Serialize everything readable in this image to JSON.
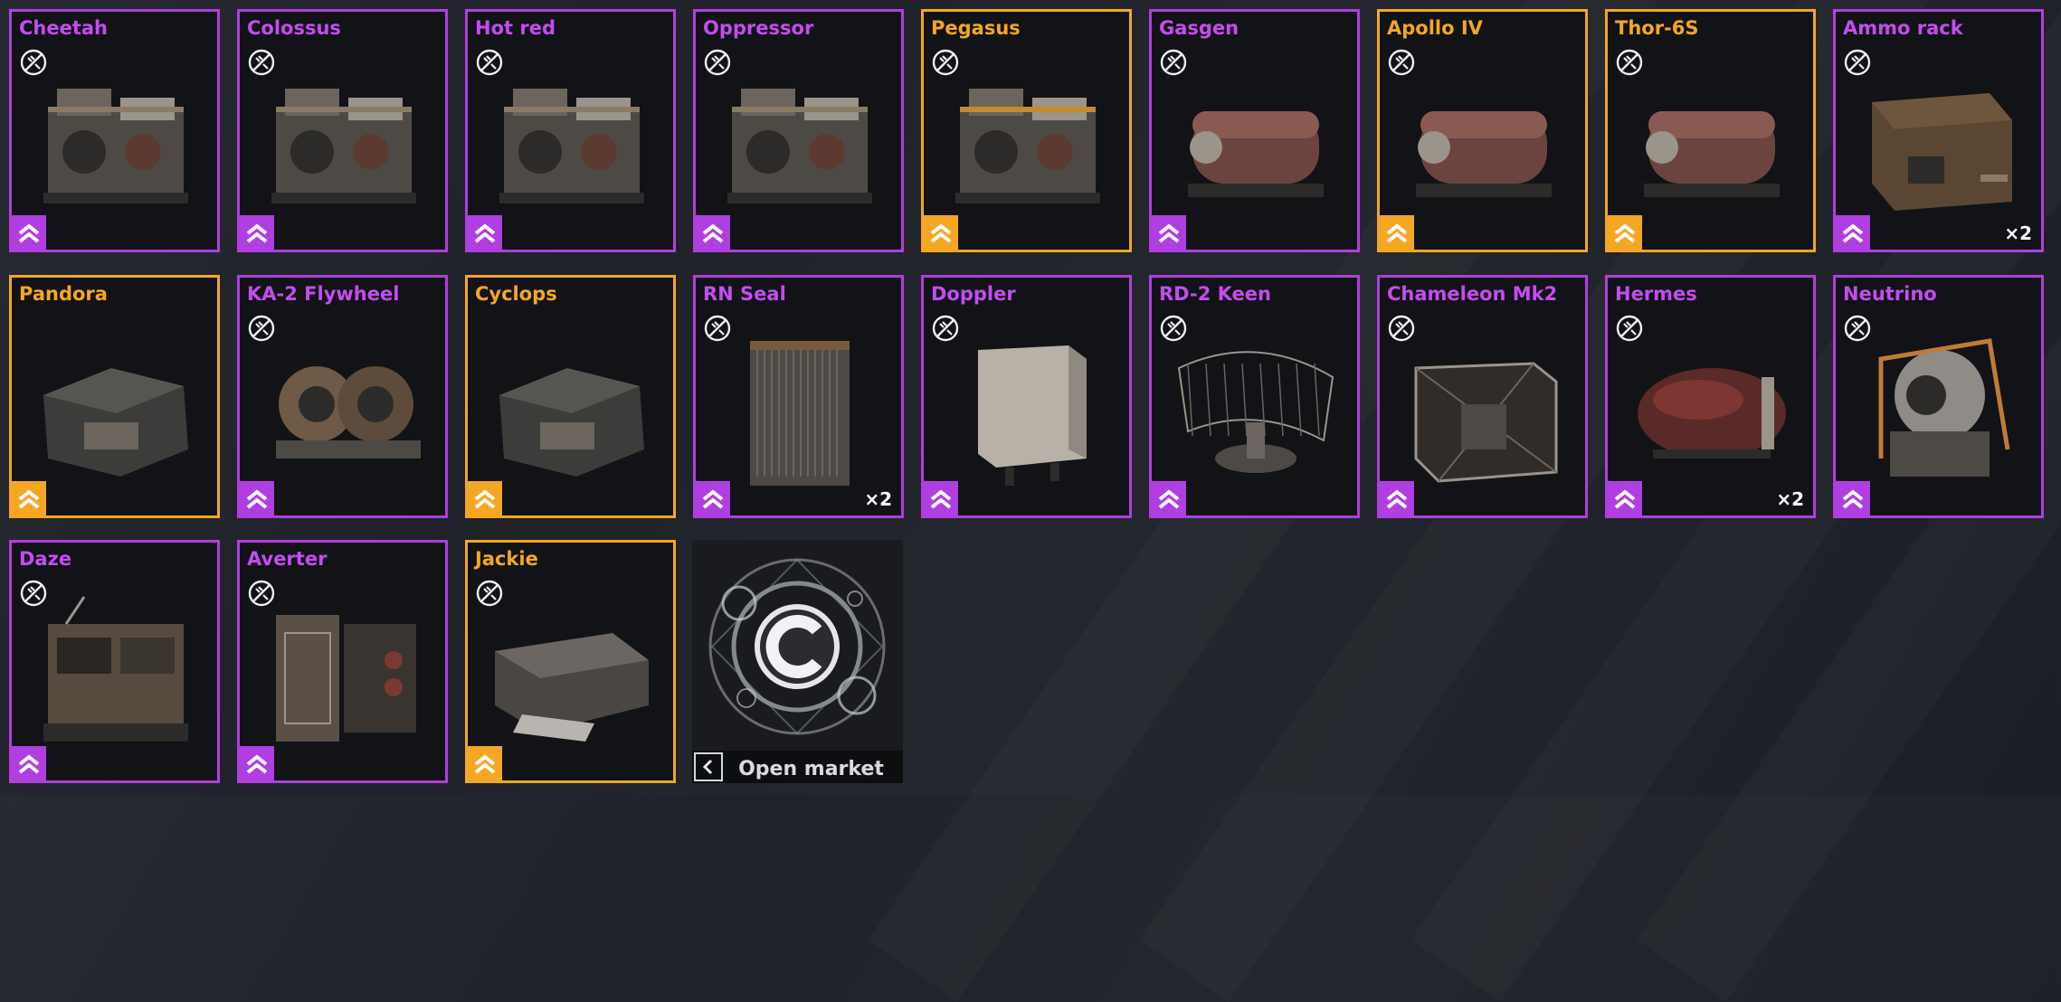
{
  "colors": {
    "epic": "#b03ee0",
    "legendary": "#f5a623",
    "card_bg": "#111316",
    "page_bg": "#22252b"
  },
  "cards": [
    {
      "name": "Cheetah",
      "rarity": "epic",
      "crafting_disabled": true,
      "quantity": null,
      "icon": "engine-icon"
    },
    {
      "name": "Colossus",
      "rarity": "epic",
      "crafting_disabled": true,
      "quantity": null,
      "icon": "engine-icon"
    },
    {
      "name": "Hot red",
      "rarity": "epic",
      "crafting_disabled": true,
      "quantity": null,
      "icon": "engine-icon"
    },
    {
      "name": "Oppressor",
      "rarity": "epic",
      "crafting_disabled": true,
      "quantity": null,
      "icon": "engine-icon"
    },
    {
      "name": "Pegasus",
      "rarity": "legendary",
      "crafting_disabled": true,
      "quantity": null,
      "icon": "engine-icon"
    },
    {
      "name": "Gasgen",
      "rarity": "epic",
      "crafting_disabled": true,
      "quantity": null,
      "icon": "generator-icon"
    },
    {
      "name": "Apollo IV",
      "rarity": "legendary",
      "crafting_disabled": true,
      "quantity": null,
      "icon": "generator-icon"
    },
    {
      "name": "Thor-6S",
      "rarity": "legendary",
      "crafting_disabled": true,
      "quantity": null,
      "icon": "generator-icon"
    },
    {
      "name": "Ammo rack",
      "rarity": "epic",
      "crafting_disabled": true,
      "quantity": "×2",
      "icon": "crate-icon"
    },
    {
      "name": "Pandora",
      "rarity": "legendary",
      "crafting_disabled": false,
      "quantity": null,
      "icon": "module-icon"
    },
    {
      "name": "KA-2 Flywheel",
      "rarity": "epic",
      "crafting_disabled": true,
      "quantity": null,
      "icon": "flywheel-icon"
    },
    {
      "name": "Cyclops",
      "rarity": "legendary",
      "crafting_disabled": false,
      "quantity": null,
      "icon": "module-icon"
    },
    {
      "name": "RN Seal",
      "rarity": "epic",
      "crafting_disabled": true,
      "quantity": "×2",
      "icon": "radiator-icon"
    },
    {
      "name": "Doppler",
      "rarity": "epic",
      "crafting_disabled": true,
      "quantity": null,
      "icon": "radar-box-icon"
    },
    {
      "name": "RD-2 Keen",
      "rarity": "epic",
      "crafting_disabled": true,
      "quantity": null,
      "icon": "radar-dish-icon"
    },
    {
      "name": "Chameleon Mk2",
      "rarity": "epic",
      "crafting_disabled": true,
      "quantity": null,
      "icon": "cage-icon"
    },
    {
      "name": "Hermes",
      "rarity": "epic",
      "crafting_disabled": true,
      "quantity": "×2",
      "icon": "tank-icon"
    },
    {
      "name": "Neutrino",
      "rarity": "epic",
      "crafting_disabled": true,
      "quantity": null,
      "icon": "diving-helmet-icon"
    },
    {
      "name": "Daze",
      "rarity": "epic",
      "crafting_disabled": true,
      "quantity": null,
      "icon": "console-icon"
    },
    {
      "name": "Averter",
      "rarity": "epic",
      "crafting_disabled": true,
      "quantity": null,
      "icon": "electronics-icon"
    },
    {
      "name": "Jackie",
      "rarity": "legendary",
      "crafting_disabled": true,
      "quantity": null,
      "icon": "plate-icon"
    }
  ],
  "market": {
    "label": "Open market",
    "icon": "crossout-logo-icon",
    "back_icon": "chevron-left-icon"
  }
}
